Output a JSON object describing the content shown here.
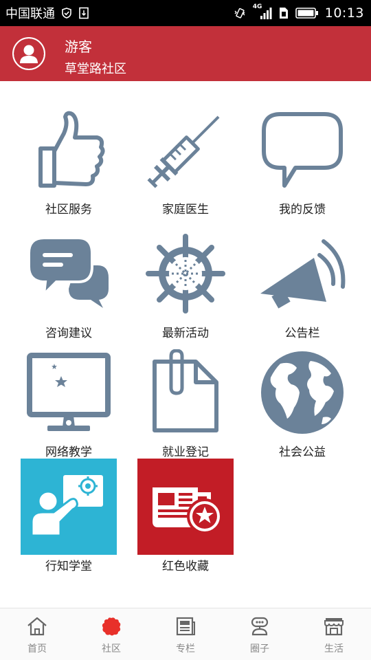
{
  "status_bar": {
    "carrier": "中国联通",
    "network": "4G",
    "time": "10:13"
  },
  "header": {
    "user_name": "游客",
    "community": "草堂路社区",
    "accent_color": "#c2303a"
  },
  "grid": {
    "icon_color": "#6b8299",
    "items": [
      {
        "label": "社区服务",
        "icon": "thumbs-up-icon"
      },
      {
        "label": "家庭医生",
        "icon": "syringe-icon"
      },
      {
        "label": "我的反馈",
        "icon": "speech-bubble-icon"
      },
      {
        "label": "咨询建议",
        "icon": "chat-bubbles-icon"
      },
      {
        "label": "最新活动",
        "icon": "ship-wheel-icon"
      },
      {
        "label": "公告栏",
        "icon": "megaphone-icon"
      },
      {
        "label": "网络教学",
        "icon": "monitor-moon-icon"
      },
      {
        "label": "就业登记",
        "icon": "paperclip-document-icon"
      },
      {
        "label": "社会公益",
        "icon": "globe-icon"
      },
      {
        "label": "行知学堂",
        "icon": "teacher-board-icon"
      },
      {
        "label": "红色收藏",
        "icon": "newspaper-star-icon"
      }
    ]
  },
  "bottom_nav": {
    "active_color": "#e8302a",
    "items": [
      {
        "label": "首页",
        "icon": "home-icon",
        "active": false
      },
      {
        "label": "社区",
        "icon": "community-icon",
        "active": true
      },
      {
        "label": "专栏",
        "icon": "newspaper-icon",
        "active": false
      },
      {
        "label": "圈子",
        "icon": "circle-icon",
        "active": false
      },
      {
        "label": "生活",
        "icon": "shop-icon",
        "active": false
      }
    ]
  }
}
